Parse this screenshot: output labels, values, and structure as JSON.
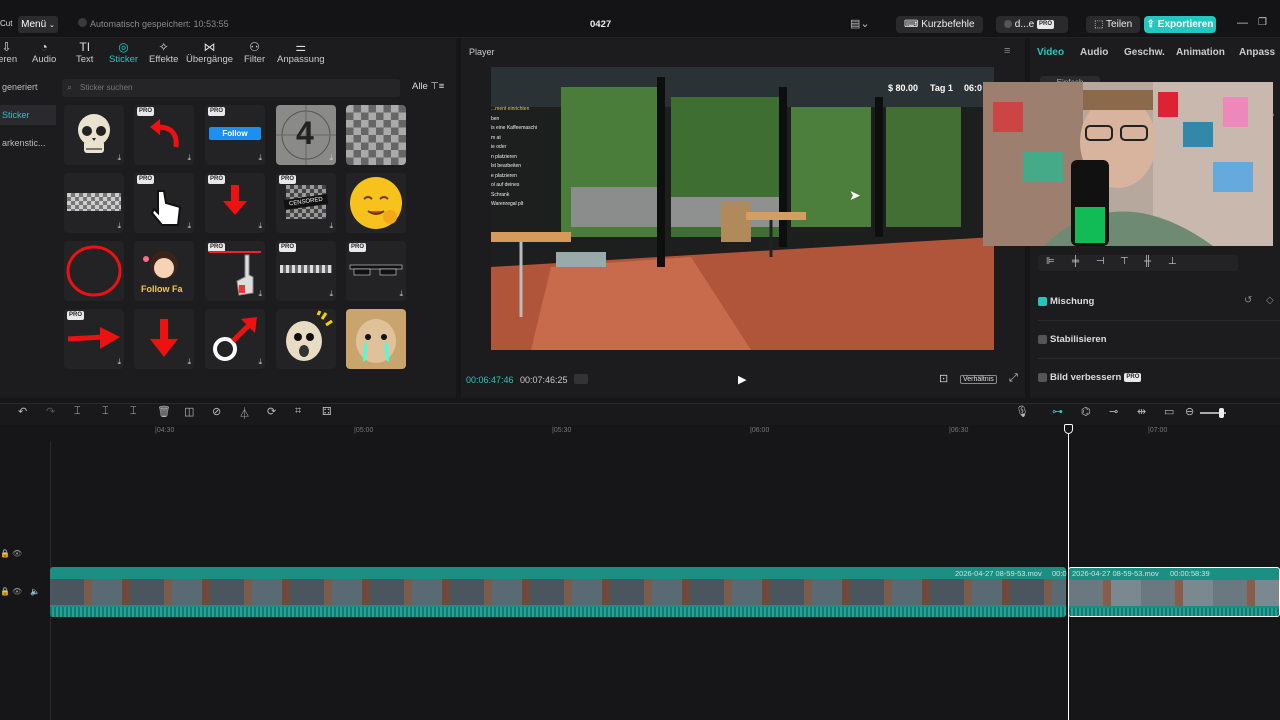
{
  "topbar": {
    "logo_text": "Cut",
    "menu_label": "Menü",
    "autosave_text": "Automatisch gespeichert: 10:53:55",
    "project_title": "0427",
    "shortcuts_label": "Kurzbefehle",
    "user_label": "d...e",
    "pro_badge": "PRO",
    "share_label": "Teilen",
    "export_label": "Exportieren"
  },
  "left_tools": [
    {
      "label": "ieren",
      "icon": "import-icon"
    },
    {
      "label": "Audio",
      "icon": "audio-icon"
    },
    {
      "label": "Text",
      "icon": "text-icon"
    },
    {
      "label": "Sticker",
      "icon": "sticker-icon"
    },
    {
      "label": "Effekte",
      "icon": "effects-icon"
    },
    {
      "label": "Übergänge",
      "icon": "transitions-icon"
    },
    {
      "label": "Filter",
      "icon": "filter-icon"
    },
    {
      "label": "Anpassung",
      "icon": "adjust-icon"
    }
  ],
  "categories": [
    "generiert",
    "Sticker",
    "arkenstic..."
  ],
  "search_placeholder": "Sticker suchen",
  "filter_label": "Alle",
  "sticker_texts": {
    "follow": "Follow",
    "four": "4",
    "censored": "CENSORED",
    "follow_fa": "Follow Fa"
  },
  "player": {
    "title": "Player",
    "current_time": "00:06:47:46",
    "total_time": "00:07:46:25",
    "ratio_label": "Verhältnis",
    "hud_money": "$ 80.00",
    "hud_day": "Tag 1",
    "hud_time": "06:0",
    "overlay_lines": [
      "...ment einrichten",
      "ben",
      "is eine Kaffeemaschi",
      "m at",
      "ie oder",
      "n platzieren",
      "lst bearbeiten",
      "e platzieren",
      "ol auf deines",
      "Schrank",
      "Warenregal plt"
    ]
  },
  "right_tabs": [
    "Video",
    "Audio",
    "Geschw.",
    "Animation",
    "Anpass"
  ],
  "right_panel": {
    "sub_tab": "Einfach",
    "mix_label": "Mischung",
    "stabilize_label": "Stabilisieren",
    "enhance_label": "Bild verbessern"
  },
  "ruler_ticks": [
    "|04:30",
    "|05:00",
    "|05:30",
    "|06:00",
    "|06:30",
    "|07:00"
  ],
  "clips": [
    {
      "name": "2026-04-27 08-59-53.mov",
      "duration": "00:0"
    },
    {
      "name": "2026-04-27 08-59-53.mov",
      "duration": "00:00:58:39"
    }
  ],
  "colors": {
    "accent": "#21c8c0",
    "bg": "#161618",
    "panel": "#1c1c1f",
    "clip": "#1c8f83"
  }
}
